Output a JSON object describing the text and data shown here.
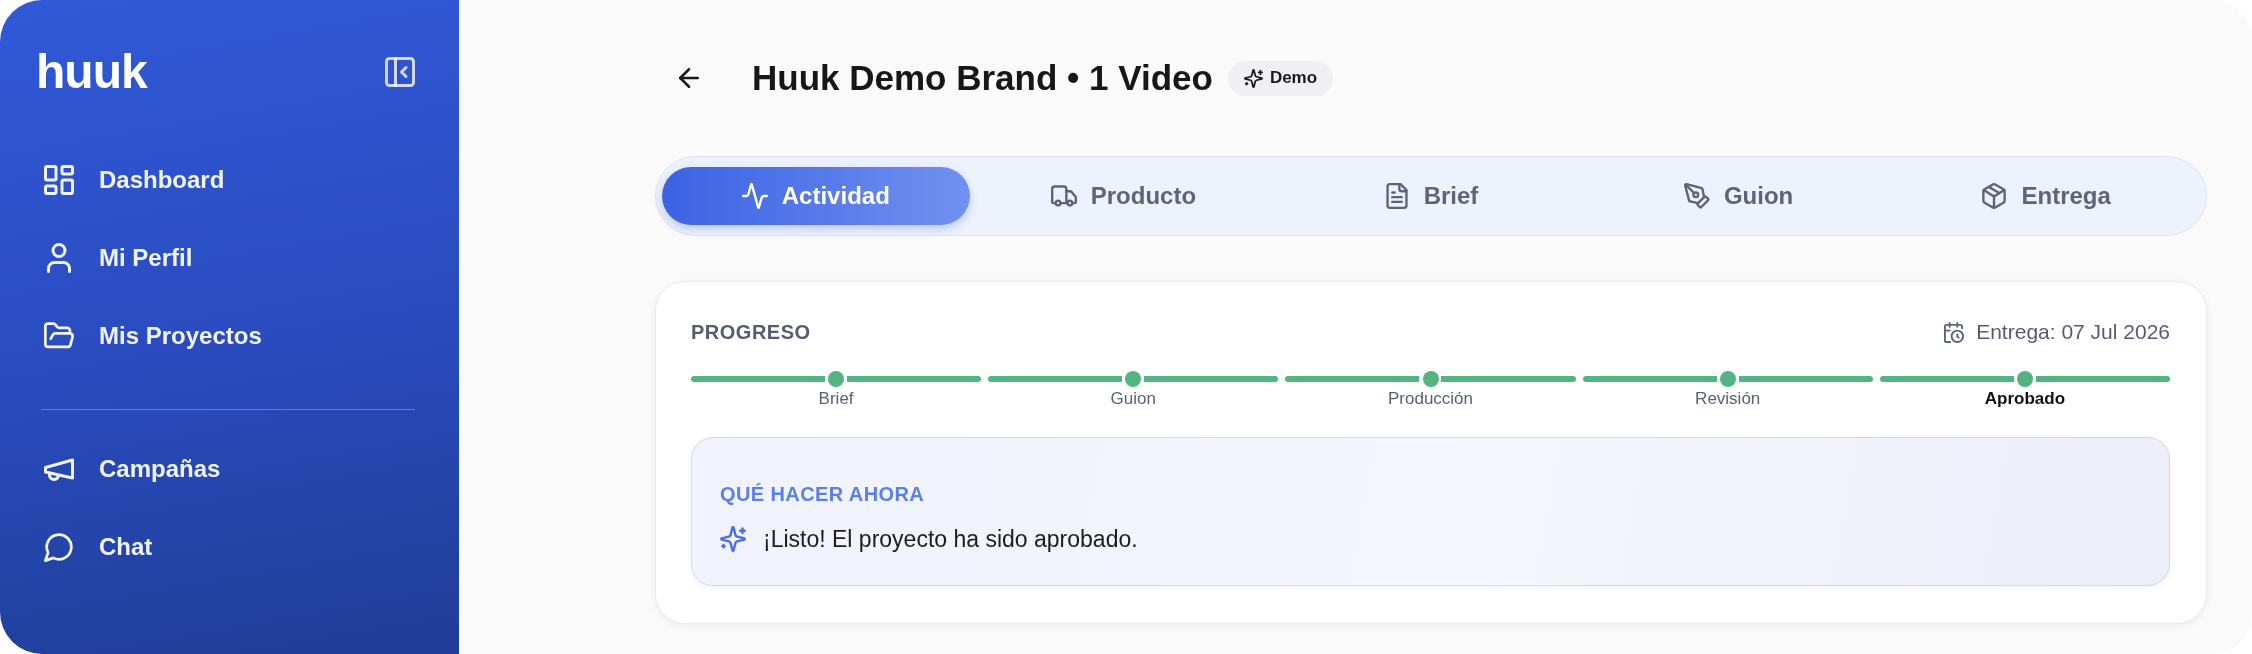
{
  "sidebar": {
    "logo": "huuk",
    "nav_items": [
      {
        "label": "Dashboard",
        "selected": false
      },
      {
        "label": "Mi Perfil",
        "selected": false
      },
      {
        "label": "Mis Proyectos",
        "selected": false
      }
    ],
    "secondary_items": [
      {
        "label": "Campañas",
        "selected": false
      },
      {
        "label": "Chat",
        "selected": false
      }
    ]
  },
  "header": {
    "title": "Huuk Demo Brand • 1 Video",
    "tag": "Demo"
  },
  "tabs": [
    {
      "label": "Actividad",
      "selected": true
    },
    {
      "label": "Producto",
      "selected": false
    },
    {
      "label": "Brief",
      "selected": false
    },
    {
      "label": "Guion",
      "selected": false
    },
    {
      "label": "Entrega",
      "selected": false
    }
  ],
  "progress": {
    "title": "PROGRESO",
    "due_date": "Entrega: 07 Jul 2026",
    "steps": [
      {
        "label": "Brief",
        "done": true,
        "current": false
      },
      {
        "label": "Guion",
        "done": true,
        "current": false
      },
      {
        "label": "Producción",
        "done": true,
        "current": false
      },
      {
        "label": "Revisión",
        "done": true,
        "current": false
      },
      {
        "label": "Aprobado",
        "done": true,
        "current": true
      }
    ]
  },
  "next_step": {
    "title": "QUÉ HACER AHORA",
    "message": "¡Listo! El proyecto ha sido aprobado."
  }
}
